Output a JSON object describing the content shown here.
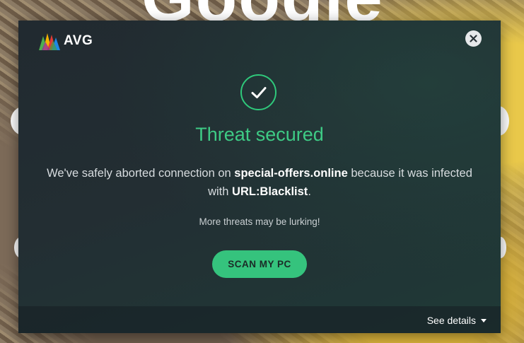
{
  "background": {
    "text": "Google"
  },
  "dialog": {
    "brand": "AVG",
    "close_icon": "close-icon",
    "status_icon": "checkmark-icon",
    "title": "Threat secured",
    "message": {
      "prefix": "We've safely aborted connection on ",
      "site": "special-offers.online",
      "middle": " because it was infected with ",
      "threat": "URL:Blacklist",
      "suffix": "."
    },
    "subtext": "More threats may be lurking!",
    "scan_button": "SCAN MY PC",
    "footer": {
      "details_label": "See details",
      "details_icon": "caret-down-icon"
    }
  },
  "colors": {
    "accent_green": "#35c37d",
    "title_green": "#3ecb85",
    "dialog_bg": "#232e33"
  }
}
